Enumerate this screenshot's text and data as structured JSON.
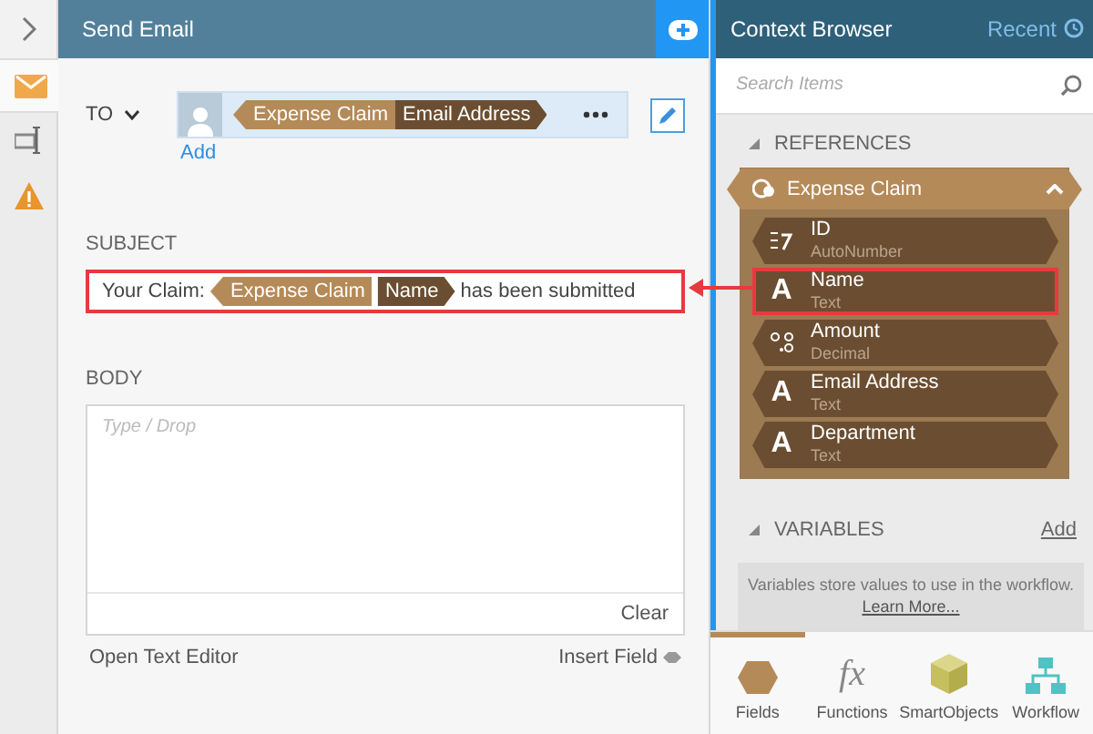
{
  "rail": {
    "tabs": [
      {
        "kind": "email",
        "selected": true
      },
      {
        "kind": "text-field",
        "selected": false
      },
      {
        "kind": "warning",
        "selected": false
      }
    ]
  },
  "editor": {
    "title": "Send Email",
    "to": {
      "label": "TO",
      "tokens": [
        {
          "kind": "object",
          "text": "Expense Claim"
        },
        {
          "kind": "field",
          "text": "Email Address"
        }
      ],
      "add": "Add"
    },
    "subject": {
      "label": "SUBJECT",
      "highlighted": true,
      "parts": [
        {
          "kind": "text",
          "text": "Your Claim:"
        },
        {
          "kind": "object",
          "text": "Expense Claim"
        },
        {
          "kind": "field",
          "text": "Name"
        },
        {
          "kind": "text",
          "text": "has been submitted"
        }
      ]
    },
    "body": {
      "label": "BODY",
      "placeholder": "Type / Drop",
      "clear": "Clear",
      "open_editor": "Open Text Editor",
      "insert_field": "Insert Field"
    }
  },
  "browser": {
    "title": "Context Browser",
    "recent": "Recent",
    "search": {
      "placeholder": "Search Items"
    },
    "references": {
      "label": "REFERENCES",
      "expanded": true,
      "group": {
        "name": "Expense Claim",
        "expanded": true,
        "items": [
          {
            "name": "ID",
            "type": "AutoNumber",
            "kind": "autonumber",
            "highlighted": false
          },
          {
            "name": "Name",
            "type": "Text",
            "kind": "text",
            "icon": "A",
            "highlighted": true
          },
          {
            "name": "Amount",
            "type": "Decimal",
            "kind": "decimal",
            "highlighted": false
          },
          {
            "name": "Email Address",
            "type": "Text",
            "kind": "text",
            "icon": "A",
            "highlighted": false
          },
          {
            "name": "Department",
            "type": "Text",
            "kind": "text",
            "icon": "A",
            "highlighted": false
          }
        ]
      }
    },
    "variables": {
      "label": "VARIABLES",
      "expanded": true,
      "add": "Add",
      "description": "Variables store values to use in the workflow.",
      "link": "Learn More..."
    },
    "toolbar": [
      {
        "kind": "fields",
        "label": "Fields",
        "selected": true
      },
      {
        "kind": "functions",
        "label": "Functions",
        "icon": "fx",
        "selected": false
      },
      {
        "kind": "smartobjects",
        "label": "SmartObjects",
        "selected": false
      },
      {
        "kind": "workflow",
        "label": "Workflow",
        "selected": false
      }
    ]
  }
}
